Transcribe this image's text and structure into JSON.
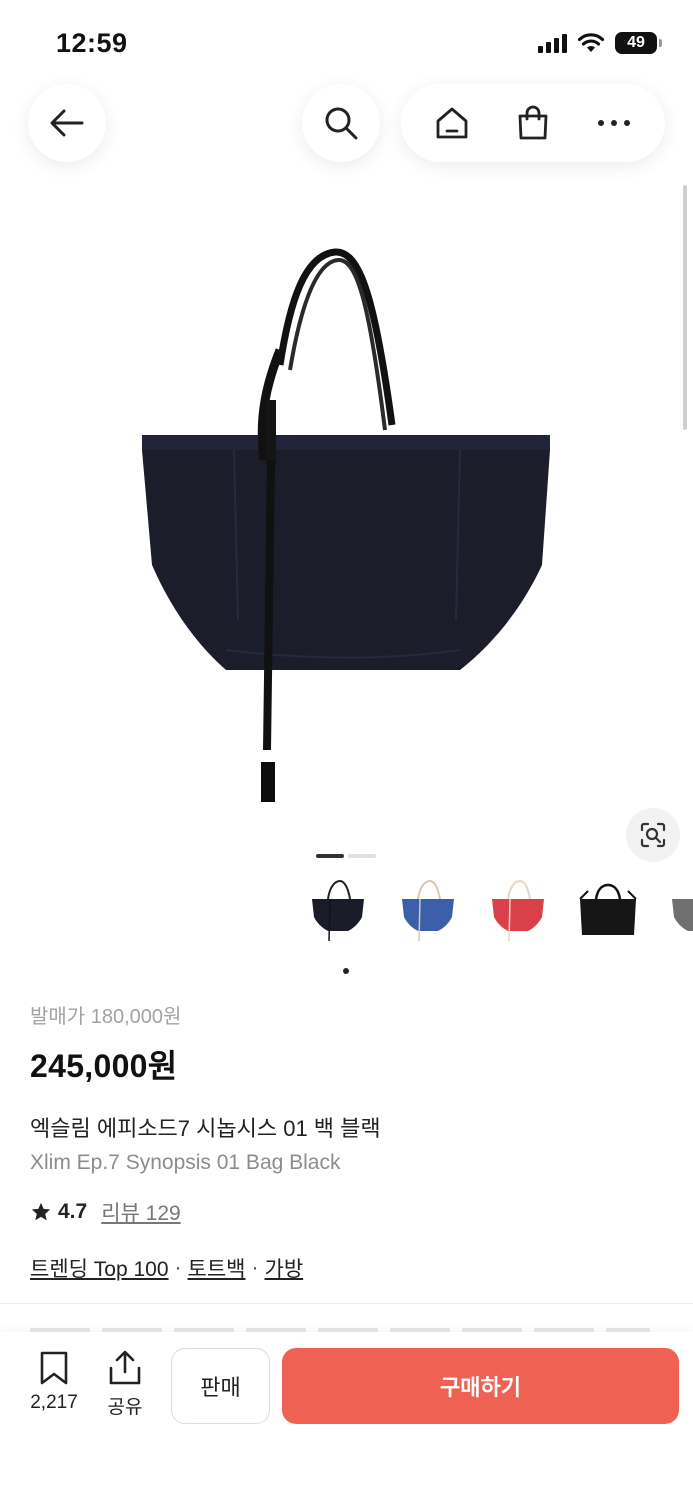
{
  "status_bar": {
    "time": "12:59",
    "battery": "49"
  },
  "nav": {
    "back_icon": "arrow-left-icon",
    "search_icon": "search-icon",
    "home_icon": "home-icon",
    "bag_icon": "shopping-bag-icon",
    "more_icon": "more-icon"
  },
  "gallery": {
    "page_count": 2,
    "current_page": 1
  },
  "thumbnails": [
    {
      "color": "#1a1c2a"
    },
    {
      "color": "#3b5fa8"
    },
    {
      "color": "#d9404a"
    },
    {
      "color": "#161616"
    },
    {
      "color": "#6f6f6f"
    }
  ],
  "product": {
    "release_price": "발매가 180,000원",
    "price": "245,000원",
    "name_ko": "엑슬림 에피소드7 시놉시스 01 백 블랙",
    "name_en": "Xlim Ep.7 Synopsis 01 Bag Black",
    "rating": "4.7",
    "reviews": "리뷰 129",
    "tags": [
      "트렌딩 Top 100",
      "토트백",
      "가방"
    ]
  },
  "bottom": {
    "bookmark_count": "2,217",
    "share_label": "공유",
    "sell_label": "판매",
    "buy_label": "구매하기",
    "buy_color": "#ef6253"
  }
}
